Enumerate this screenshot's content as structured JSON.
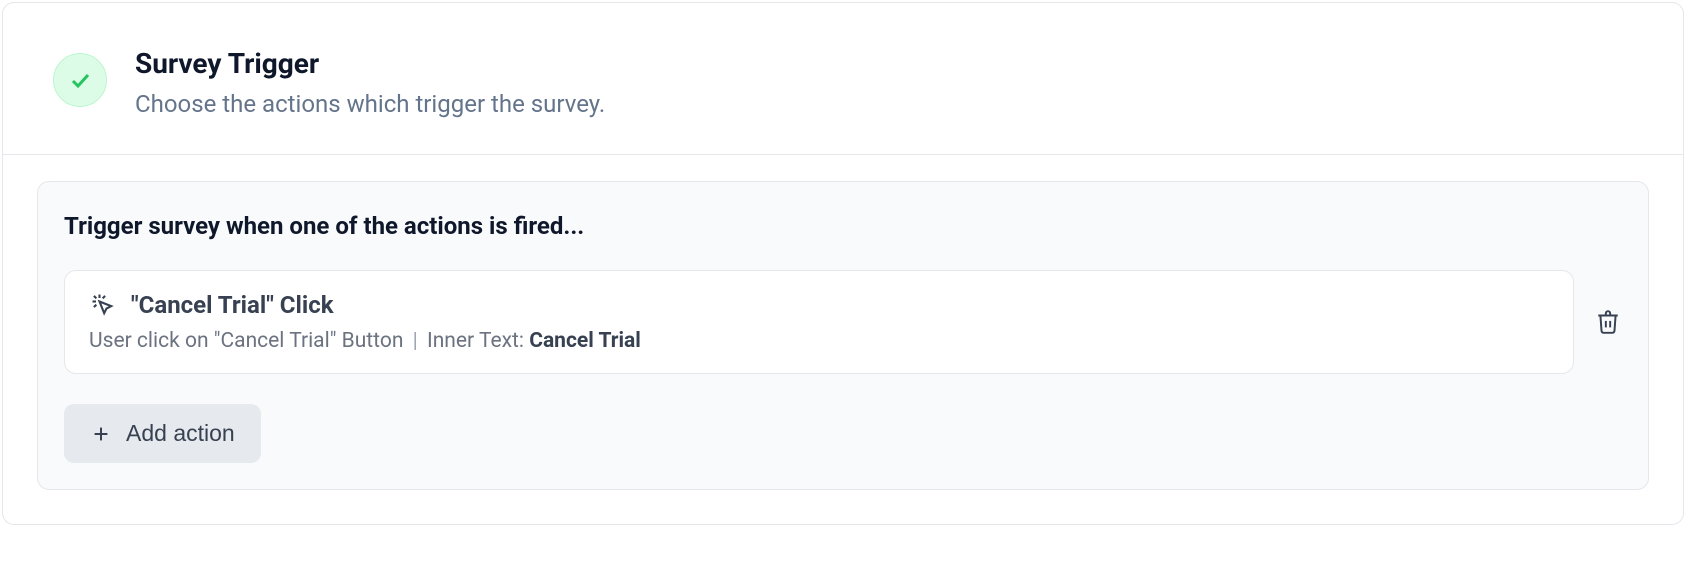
{
  "header": {
    "title": "Survey Trigger",
    "subtitle": "Choose the actions which trigger the survey."
  },
  "section": {
    "title": "Trigger survey when one of the actions is fired...",
    "addActionLabel": "Add action"
  },
  "actions": [
    {
      "title": "\"Cancel Trial\" Click",
      "descriptionPrefix": "User click on \"Cancel Trial\" Button",
      "innerTextLabel": "Inner Text:",
      "innerTextValue": "Cancel Trial"
    }
  ]
}
